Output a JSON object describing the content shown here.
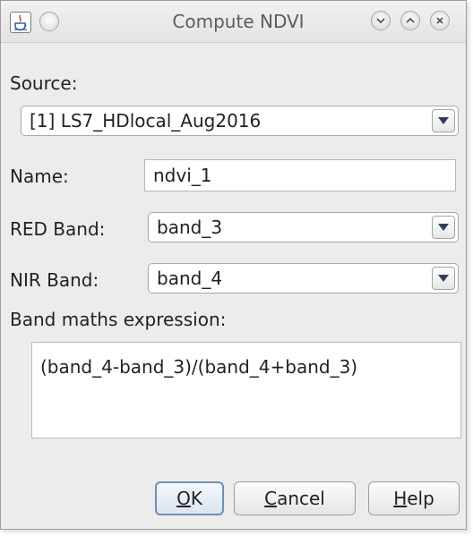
{
  "window": {
    "title": "Compute NDVI",
    "icons": [
      "java-app-icon",
      "window-menu-dot",
      "minimize-icon",
      "maximize-icon",
      "close-icon"
    ]
  },
  "source": {
    "label": "Source:",
    "selected": "[1] LS7_HDlocal_Aug2016"
  },
  "name": {
    "label": "Name:",
    "value": "ndvi_1"
  },
  "red_band": {
    "label": "RED Band:",
    "selected": "band_3"
  },
  "nir_band": {
    "label": "NIR Band:",
    "selected": "band_4"
  },
  "expression": {
    "label": "Band maths expression:",
    "value": "(band_4-band_3)/(band_4+band_3)"
  },
  "buttons": {
    "ok": {
      "mnemonic": "O",
      "rest": "K"
    },
    "cancel": {
      "mnemonic": "C",
      "rest": "ancel"
    },
    "help": {
      "mnemonic": "H",
      "rest": "elp"
    }
  },
  "colors": {
    "focus_border": "#6f8fb6",
    "background": "#ececec"
  }
}
